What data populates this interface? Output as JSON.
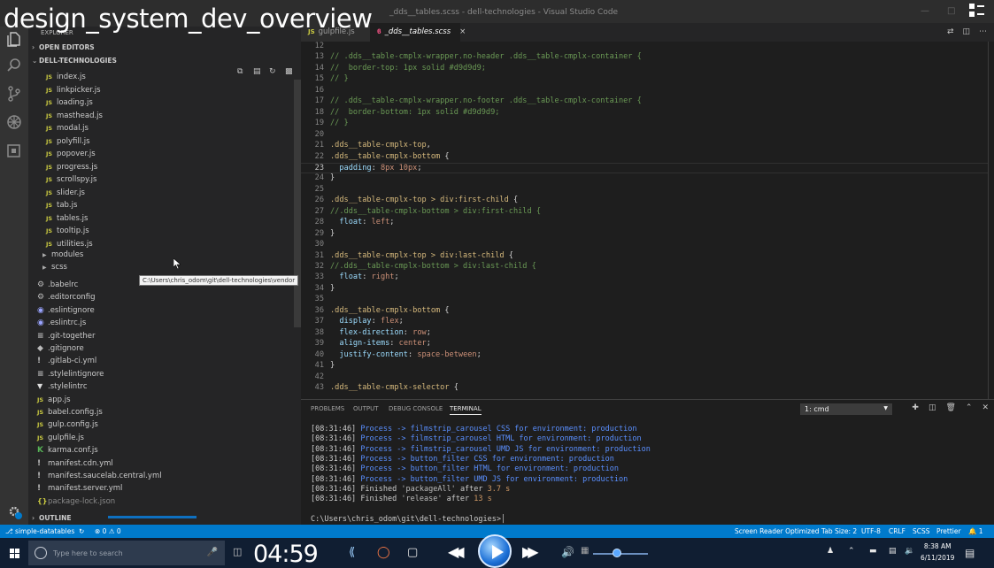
{
  "overlay_title": "design_system_dev_overview",
  "window_title": "_dds__tables.scss - dell-technologies - Visual Studio Code",
  "sidebar": {
    "header": "EXPLORER",
    "open_editors": "OPEN EDITORS",
    "project": "DELL-TECHNOLOGIES",
    "js_files": [
      "index.js",
      "linkpicker.js",
      "loading.js",
      "masthead.js",
      "modal.js",
      "polyfill.js",
      "popover.js",
      "progress.js",
      "scrollspy.js",
      "slider.js",
      "tab.js",
      "tables.js",
      "tooltip.js",
      "utilities.js"
    ],
    "folders": [
      "modules",
      "scss"
    ],
    "tooltip": "C:\\Users\\chris_odom\\git\\dell-technologies\\vendor",
    "root_files": [
      ".babelrc",
      ".editorconfig",
      ".eslintignore",
      ".eslintrc.js",
      ".git-together",
      ".gitignore",
      ".gitlab-ci.yml",
      ".stylelintignore",
      ".stylelintrc",
      "app.js",
      "babel.config.js",
      "gulp.config.js",
      "gulpfile.js",
      "karma.conf.js",
      "manifest.cdn.yml",
      "manifest.saucelab.central.yml",
      "manifest.server.yml",
      "package-lock.json"
    ],
    "outline": "OUTLINE",
    "js_badge": "JS"
  },
  "tabs": [
    {
      "icon": "JS",
      "label": "gulpfile.js"
    },
    {
      "icon": "ϐ",
      "label": "_dds__tables.scss",
      "close": "×"
    }
  ],
  "editor": {
    "lines": [
      {
        "n": "12",
        "parts": []
      },
      {
        "n": "13",
        "parts": [
          [
            "cm",
            "// .dds__table-cmplx-wrapper.no-header .dds__table-cmplx-container {"
          ]
        ]
      },
      {
        "n": "14",
        "parts": [
          [
            "cm",
            "//  border-top: 1px solid #d9d9d9;"
          ]
        ]
      },
      {
        "n": "15",
        "parts": [
          [
            "cm",
            "// }"
          ]
        ]
      },
      {
        "n": "16",
        "parts": []
      },
      {
        "n": "17",
        "parts": [
          [
            "cm",
            "// .dds__table-cmplx-wrapper.no-footer .dds__table-cmplx-container {"
          ]
        ]
      },
      {
        "n": "18",
        "parts": [
          [
            "cm",
            "//  border-bottom: 1px solid #d9d9d9;"
          ]
        ]
      },
      {
        "n": "19",
        "parts": [
          [
            "cm",
            "// }"
          ]
        ]
      },
      {
        "n": "20",
        "parts": []
      },
      {
        "n": "21",
        "parts": [
          [
            "sel",
            ".dds__table-cmplx-top"
          ],
          [
            "pn",
            ","
          ]
        ]
      },
      {
        "n": "22",
        "parts": [
          [
            "sel",
            ".dds__table-cmplx-bottom"
          ],
          [
            "pn",
            " {"
          ]
        ]
      },
      {
        "n": "23",
        "parts": [
          [
            "pn",
            "  "
          ],
          [
            "pr",
            "padding"
          ],
          [
            "pn",
            ": "
          ],
          [
            "vl",
            "8px 10px"
          ],
          [
            "pn",
            ";"
          ]
        ],
        "current": true
      },
      {
        "n": "24",
        "parts": [
          [
            "pn",
            "}"
          ]
        ]
      },
      {
        "n": "25",
        "parts": []
      },
      {
        "n": "26",
        "parts": [
          [
            "sel",
            ".dds__table-cmplx-top > div:first-child"
          ],
          [
            "pn",
            " {"
          ]
        ]
      },
      {
        "n": "27",
        "parts": [
          [
            "cm",
            "//.dds__table-cmplx-bottom > div:first-child {"
          ]
        ]
      },
      {
        "n": "28",
        "parts": [
          [
            "pn",
            "  "
          ],
          [
            "pr",
            "float"
          ],
          [
            "pn",
            ": "
          ],
          [
            "vl",
            "left"
          ],
          [
            "pn",
            ";"
          ]
        ]
      },
      {
        "n": "29",
        "parts": [
          [
            "pn",
            "}"
          ]
        ]
      },
      {
        "n": "30",
        "parts": []
      },
      {
        "n": "31",
        "parts": [
          [
            "sel",
            ".dds__table-cmplx-top > div:last-child"
          ],
          [
            "pn",
            " {"
          ]
        ]
      },
      {
        "n": "32",
        "parts": [
          [
            "cm",
            "//.dds__table-cmplx-bottom > div:last-child {"
          ]
        ]
      },
      {
        "n": "33",
        "parts": [
          [
            "pn",
            "  "
          ],
          [
            "pr",
            "float"
          ],
          [
            "pn",
            ": "
          ],
          [
            "vl",
            "right"
          ],
          [
            "pn",
            ";"
          ]
        ]
      },
      {
        "n": "34",
        "parts": [
          [
            "pn",
            "}"
          ]
        ]
      },
      {
        "n": "35",
        "parts": []
      },
      {
        "n": "36",
        "parts": [
          [
            "sel",
            ".dds__table-cmplx-bottom"
          ],
          [
            "pn",
            " {"
          ]
        ]
      },
      {
        "n": "37",
        "parts": [
          [
            "pn",
            "  "
          ],
          [
            "pr",
            "display"
          ],
          [
            "pn",
            ": "
          ],
          [
            "vl",
            "flex"
          ],
          [
            "pn",
            ";"
          ]
        ]
      },
      {
        "n": "38",
        "parts": [
          [
            "pn",
            "  "
          ],
          [
            "pr",
            "flex-direction"
          ],
          [
            "pn",
            ": "
          ],
          [
            "vl",
            "row"
          ],
          [
            "pn",
            ";"
          ]
        ]
      },
      {
        "n": "39",
        "parts": [
          [
            "pn",
            "  "
          ],
          [
            "pr",
            "align-items"
          ],
          [
            "pn",
            ": "
          ],
          [
            "vl",
            "center"
          ],
          [
            "pn",
            ";"
          ]
        ]
      },
      {
        "n": "40",
        "parts": [
          [
            "pn",
            "  "
          ],
          [
            "pr",
            "justify-content"
          ],
          [
            "pn",
            ": "
          ],
          [
            "vl",
            "space-between"
          ],
          [
            "pn",
            ";"
          ]
        ]
      },
      {
        "n": "41",
        "parts": [
          [
            "pn",
            "}"
          ]
        ]
      },
      {
        "n": "42",
        "parts": []
      },
      {
        "n": "43",
        "parts": [
          [
            "sel",
            ".dds__table-cmplx-selector"
          ],
          [
            "pn",
            " {"
          ]
        ]
      }
    ]
  },
  "panel": {
    "tabs": [
      "PROBLEMS",
      "OUTPUT",
      "DEBUG CONSOLE",
      "TERMINAL"
    ],
    "active_tab": "TERMINAL",
    "terminal_select": "1: cmd",
    "terminal_lines": [
      {
        "ts": "[08:31:46]",
        "msg": "Process -> filmstrip_carousel CSS for environment: production"
      },
      {
        "ts": "[08:31:46]",
        "msg": "Process -> filmstrip_carousel HTML for environment: production"
      },
      {
        "ts": "[08:31:46]",
        "msg": "Process -> filmstrip_carousel UMD JS for environment: production"
      },
      {
        "ts": "[08:31:46]",
        "msg": "Process -> button_filter CSS for environment: production"
      },
      {
        "ts": "[08:31:46]",
        "msg": "Process -> button_filter HTML for environment: production"
      },
      {
        "ts": "[08:31:46]",
        "msg": "Process -> button_filter UMD JS for environment: production"
      }
    ],
    "finished": [
      {
        "ts": "[08:31:46]",
        "word": "Finished",
        "task": "'packageAll'",
        "after": "after",
        "dur": "3.7 s"
      },
      {
        "ts": "[08:31:46]",
        "word": "Finished",
        "task": "'release'",
        "after": "after",
        "dur": "13 s"
      }
    ],
    "prompt": "C:\\Users\\chris_odom\\git\\dell-technologies>"
  },
  "statusbar": {
    "branch": "simple-datatables",
    "sync": "↻",
    "problems": "⊗ 0 ⚠ 0",
    "screen_reader": "Screen Reader Optimized",
    "tab_size": "Tab Size: 2",
    "encoding": "UTF-8",
    "eol": "CRLF",
    "language": "SCSS",
    "formatter": "Prettier",
    "bell": "🔔 1"
  },
  "taskbar": {
    "search_placeholder": "Type here to search",
    "timer": "04:59",
    "time": "8:38 AM",
    "date": "6/11/2019"
  }
}
